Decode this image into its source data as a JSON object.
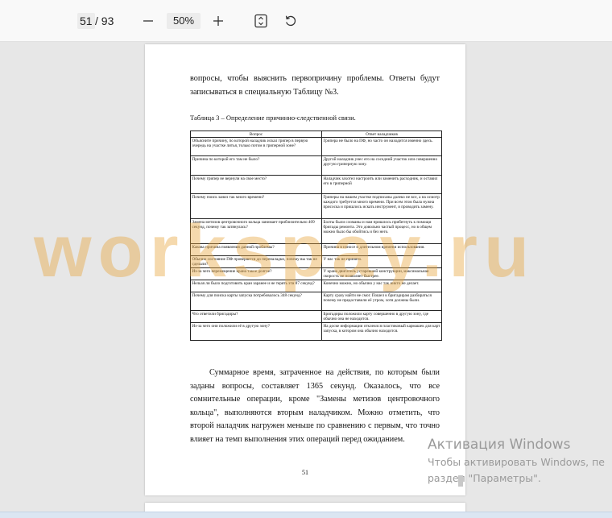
{
  "toolbar": {
    "current_page": "51",
    "total_pages": "/ 93",
    "zoom_out_icon": "minus-icon",
    "zoom_level": "50%",
    "zoom_in_icon": "plus-icon",
    "fit_icon": "fit-page-icon",
    "rotate_icon": "rotate-icon"
  },
  "document": {
    "paragraph1": "вопросы, чтобы выяснить первопричину проблемы. Ответы будут записываться в специальную Таблицу №3.",
    "table_caption": "Таблица 3 – Определение причинно-следственной связи.",
    "table_headers": [
      "Вопрос",
      "Ответ наладчиков"
    ],
    "table_rows": [
      [
        "Объясните причину, по которой наладчик искал грипер в первую очередь на участке литья, только потом в гриперной зоне?",
        "Грипера не было на ПФ, но часто он находится именно здесь."
      ],
      [
        "Причина по которой его там не было?",
        "Другой наладчик унес его на соседний участок или совершенно другую гриперную зону."
      ],
      [
        "Почему грипер не вернули на свое место?",
        "Наладчик захотел настроить или заменить расходник, и оставил его в гриперной"
      ],
      [
        "Почему поиск занял так много времени?",
        "Гриперы на нашем участке подписаны далеко не все, а на осмотр каждого требуется много времени. При всем этом была нужна присоска и пришлось искать инструмент, и проводить замену."
      ],
      [
        "Замена метизов центровочного кольца занимает приблизительно 409 секунд, почему так затянулась?",
        "Болты были сломаны и нам пришлось прибегнуть к помощи бригады ремонта. Это довольно частый процесс, но в общем можно было бы обойтись и без него."
      ],
      [
        "Какова причина появления данной проблемы?",
        "Причина в износе и длительном времени использования."
      ],
      [
        "Обычно состояние ПФ проверяется до переналадки, почему вы так не сделали?",
        "У нас так не принято."
      ],
      [
        "Из-за чего перемещение крана такое долгое?",
        "У крана двигатель устаревшей конструкции, максимальная скорость не позволяет быстрее."
      ],
      [
        "Нельзя ли было подготовить кран заранее и не терять эти 87 секунд?",
        "Конечно можно, но обычно у нас так никто не делает."
      ],
      [
        "Почему для поиска карты запуска потребовалось 348 секунд?",
        "Карту сразу найти не смог. Пошел к бригадирам разбираться почему не предоставили её утром, хотя должны были."
      ],
      [
        "Что ответили бригадиры?",
        "Бригадиры положили карту совершенно в другую зону, где обычно она не находится."
      ],
      [
        "Из-за чего они положили её в другую зону?",
        "На доске информации отклеился пластиковый кармашек для карт запуска, в котором она обычно находится."
      ]
    ],
    "paragraph2": "Суммарное время, затраченное на действия, по которым были заданы вопросы, составляет 1365 секунд. Оказалось, что все сомнительные операции, кроме \"Замены метизов центровочного кольца\", выполняются вторым наладчиком. Можно отметить, что второй наладчик нагружен меньше по сравнению с первым, что точно влияет на темп выполнения этих операций перед ожиданием.",
    "page_number": "51"
  },
  "watermark": "workspay.ru",
  "activation": {
    "title": "Активация Windows",
    "line1": "Чтобы активировать Windows, пе",
    "line2": "раздел \"Параметры\"."
  }
}
